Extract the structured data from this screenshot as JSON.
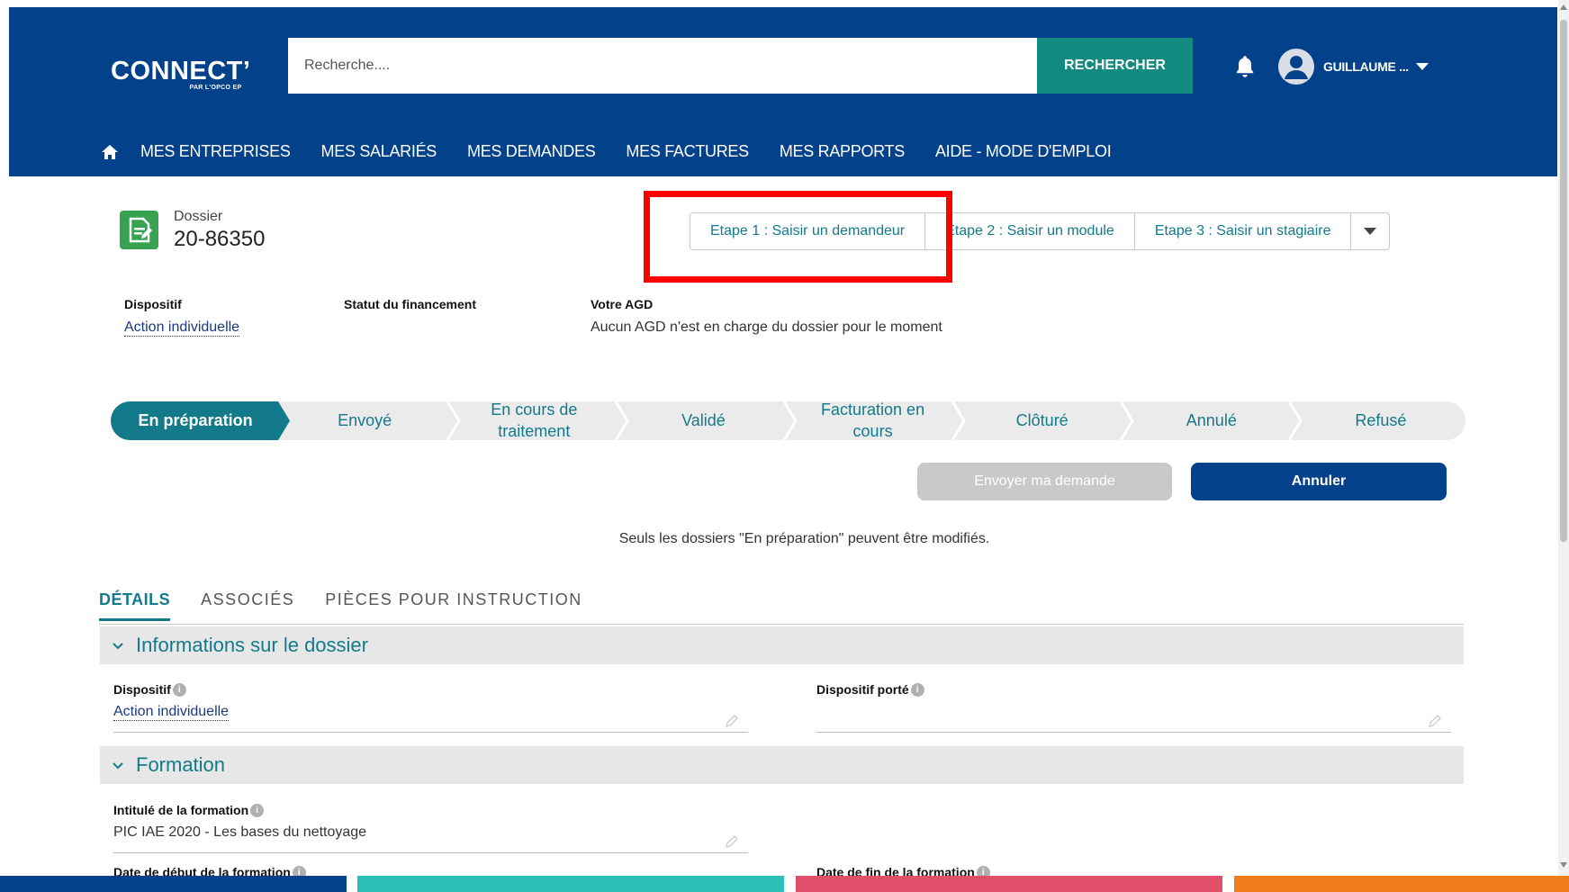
{
  "header": {
    "logo_main": "CONNECT’",
    "logo_sub": "PAR L'OPCO EP",
    "search_placeholder": "Recherche....",
    "search_button": "RECHERCHER",
    "user_name": "GUILLAUME ...",
    "nav": [
      "MES ENTREPRISES",
      "MES SALARIÉS",
      "MES DEMANDES",
      "MES FACTURES",
      "MES RAPPORTS",
      "AIDE - MODE D'EMPLOI"
    ]
  },
  "dossier": {
    "label": "Dossier",
    "number": "20-86350",
    "steps": [
      "Etape 1 : Saisir un demandeur",
      "Etape 2 : Saisir un module",
      "Etape 3 : Saisir un stagiaire"
    ],
    "info": {
      "dispositif_label": "Dispositif",
      "dispositif_value": "Action individuelle",
      "statut_label": "Statut du financement",
      "agd_label": "Votre AGD",
      "agd_value": "Aucun AGD n'est en charge du dossier pour le moment"
    }
  },
  "status_path": {
    "steps": [
      "En préparation",
      "Envoyé",
      "En cours de traitement",
      "Validé",
      "Facturation en cours",
      "Clôturé",
      "Annulé",
      "Refusé"
    ],
    "active_index": 0
  },
  "actions": {
    "send": "Envoyer ma demande",
    "cancel": "Annuler",
    "notice": "Seuls les dossiers \"En préparation\" peuvent être modifiés."
  },
  "tabs": [
    "DÉTAILS",
    "ASSOCIÉS",
    "PIÈCES POUR INSTRUCTION"
  ],
  "sections": {
    "info_title": "Informations sur le dossier",
    "formation_title": "Formation"
  },
  "fields": {
    "dispositif_label": "Dispositif",
    "dispositif_value": "Action individuelle",
    "dispositif_porte_label": "Dispositif porté",
    "intitule_label": "Intitulé de la formation",
    "intitule_value": "PIC IAE 2020 - Les bases du nettoyage",
    "date_debut_label": "Date de début de la formation",
    "date_fin_label": "Date de fin de la formation"
  },
  "colors": {
    "header_bg": "#03428a",
    "accent_teal": "#118b7f",
    "highlight": "#ff0000",
    "bottom_bar": [
      "#03428a",
      "#2bbfb9",
      "#e0506a",
      "#f07e1b"
    ]
  }
}
